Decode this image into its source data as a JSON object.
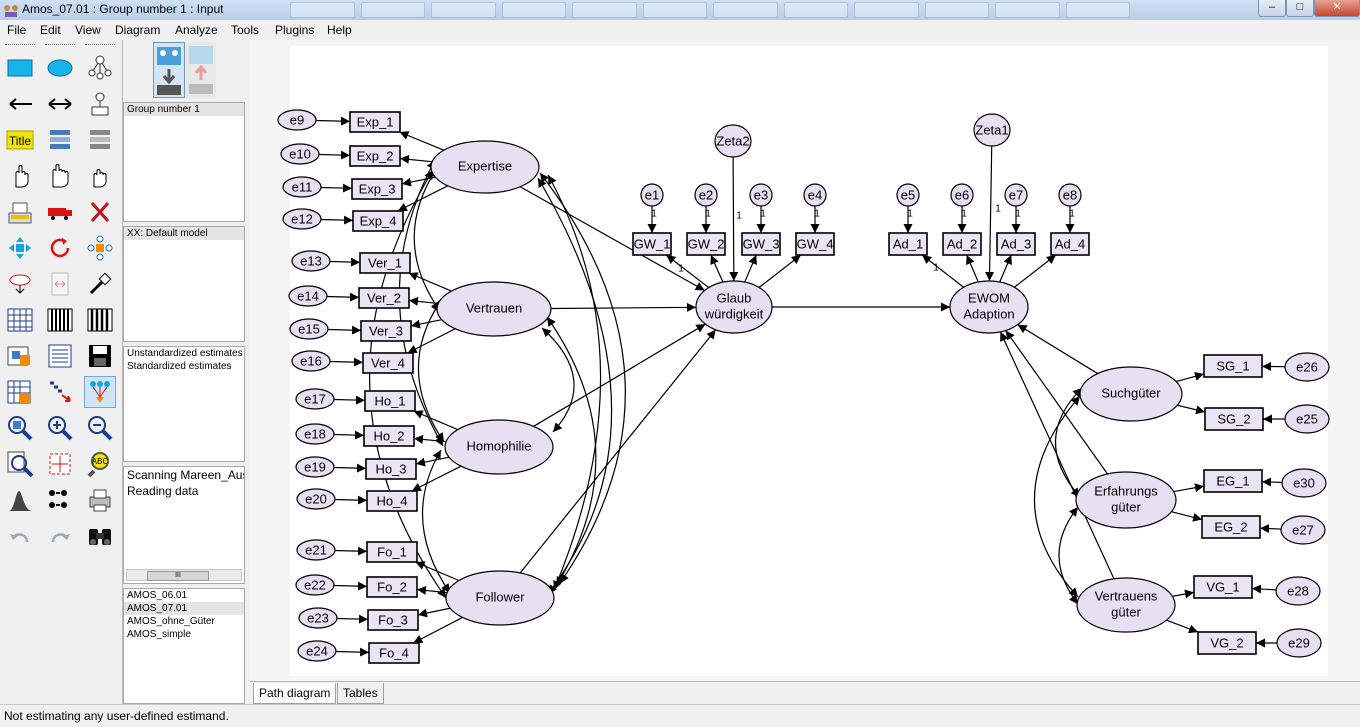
{
  "window": {
    "title": "Amos_07.01 : Group number 1 : Input",
    "controls": [
      "–",
      "□",
      "✕"
    ]
  },
  "menu": [
    "File",
    "Edit",
    "View",
    "Diagram",
    "Analyze",
    "Tools",
    "Plugins",
    "Help"
  ],
  "toolbox": {
    "title_tool_label": "Title",
    "icons": [
      "rectangle-icon",
      "ellipse-icon",
      "indicator-icon",
      "arrow-icon",
      "double-arrow-icon",
      "unique-variable-icon",
      "title-icon",
      "list-variables-icon",
      "list-dataset-icon",
      "select-one-icon",
      "select-all-icon",
      "deselect-icon",
      "copy-icon",
      "move-icon",
      "erase-icon",
      "shape-change-icon",
      "rotate-icon",
      "reflect-icon",
      "move-parameter-icon",
      "scroll-icon",
      "touch-up-icon",
      "select-data-icon",
      "analysis-properties-icon",
      "calculate-icon",
      "view-text-icon",
      "copy-clipboard-icon",
      "save-icon",
      "object-properties-icon",
      "drag-properties-icon",
      "preserve-symmetry-icon",
      "zoom-in-area-icon",
      "zoom-in-icon",
      "zoom-out-icon",
      "zoom-page-icon",
      "fit-page-icon",
      "loupe-icon",
      "bayesian-icon",
      "multigroup-icon",
      "print-icon",
      "undo-icon",
      "redo-icon",
      "specification-search-icon"
    ]
  },
  "panels": {
    "groups": [
      "Group number 1"
    ],
    "models": [
      "XX: Default model"
    ],
    "estimates": [
      "Unstandardized estimates",
      "Standardized estimates"
    ],
    "log": [
      "Scanning Mareen_Aus",
      "Reading data"
    ],
    "files": [
      "AMOS_06.01",
      "AMOS_07.01",
      "AMOS_ohne_Güter",
      "AMOS_simple"
    ],
    "selected_file": "AMOS_07.01",
    "scroll_thumb": "III"
  },
  "diagram": {
    "latents": [
      {
        "id": "expertise",
        "label": [
          "Expertise"
        ]
      },
      {
        "id": "vertrauen",
        "label": [
          "Vertrauen"
        ]
      },
      {
        "id": "homophilie",
        "label": [
          "Homophilie"
        ]
      },
      {
        "id": "follower",
        "label": [
          "Follower"
        ]
      },
      {
        "id": "glaub",
        "label": [
          "Glaub",
          "würdigkeit"
        ]
      },
      {
        "id": "ewom",
        "label": [
          "EWOM",
          "Adaption"
        ]
      },
      {
        "id": "such",
        "label": [
          "Suchgüter"
        ]
      },
      {
        "id": "erfahr",
        "label": [
          "Erfahrungs",
          "güter"
        ]
      },
      {
        "id": "vertr_g",
        "label": [
          "Vertrauens",
          "güter"
        ]
      }
    ],
    "indicators_left": [
      {
        "box": "Exp_1",
        "err": "e9"
      },
      {
        "box": "Exp_2",
        "err": "e10"
      },
      {
        "box": "Exp_3",
        "err": "e11"
      },
      {
        "box": "Exp_4",
        "err": "e12"
      },
      {
        "box": "Ver_1",
        "err": "e13"
      },
      {
        "box": "Ver_2",
        "err": "e14"
      },
      {
        "box": "Ver_3",
        "err": "e15"
      },
      {
        "box": "Ver_4",
        "err": "e16"
      },
      {
        "box": "Ho_1",
        "err": "e17"
      },
      {
        "box": "Ho_2",
        "err": "e18"
      },
      {
        "box": "Ho_3",
        "err": "e19"
      },
      {
        "box": "Ho_4",
        "err": "e20"
      },
      {
        "box": "Fo_1",
        "err": "e21"
      },
      {
        "box": "Fo_2",
        "err": "e22"
      },
      {
        "box": "Fo_3",
        "err": "e23"
      },
      {
        "box": "Fo_4",
        "err": "e24"
      }
    ],
    "indicators_top": [
      {
        "box": "GW_1",
        "err": "e1",
        "weight": "1"
      },
      {
        "box": "GW_2",
        "err": "e2",
        "weight": "1"
      },
      {
        "box": "GW_3",
        "err": "e3",
        "weight": "1"
      },
      {
        "box": "GW_4",
        "err": "e4",
        "weight": "1"
      },
      {
        "box": "Ad_1",
        "err": "e5",
        "weight": "1"
      },
      {
        "box": "Ad_2",
        "err": "e6",
        "weight": "1"
      },
      {
        "box": "Ad_3",
        "err": "e7",
        "weight": "1"
      },
      {
        "box": "Ad_4",
        "err": "e8",
        "weight": "1"
      }
    ],
    "disturbances": [
      {
        "label": "Zeta2",
        "weight": "1"
      },
      {
        "label": "Zeta1",
        "weight": "1"
      }
    ],
    "loading_labels": [
      "1",
      "1"
    ],
    "indicators_right": [
      {
        "box": "SG_1",
        "err": "e26"
      },
      {
        "box": "SG_2",
        "err": "e25"
      },
      {
        "box": "EG_1",
        "err": "e30"
      },
      {
        "box": "EG_2",
        "err": "e27"
      },
      {
        "box": "VG_1",
        "err": "e28"
      },
      {
        "box": "VG_2",
        "err": "e29"
      }
    ],
    "colors": {
      "latent_fill": "#e9dff3",
      "box_fill": "#eae4f4",
      "stroke": "#000000"
    }
  },
  "tabs": [
    "Path diagram",
    "Tables"
  ],
  "active_tab": "Path diagram",
  "status": "Not estimating any user-defined estimand."
}
